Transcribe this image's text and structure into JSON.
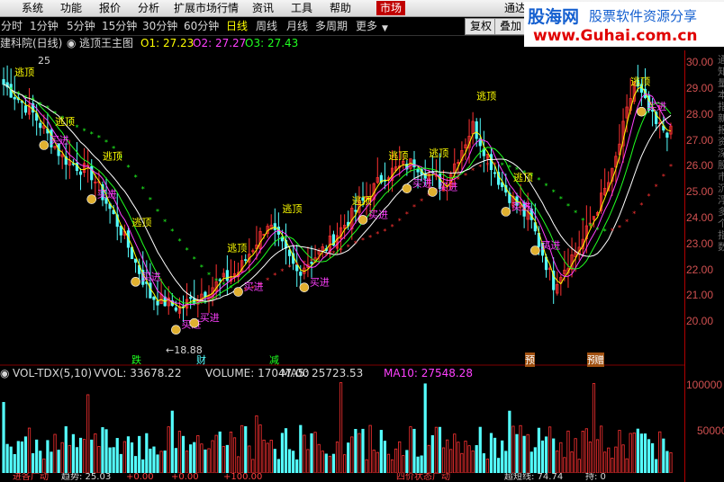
{
  "menu": [
    "系统",
    "功能",
    "报价",
    "分析",
    "扩展市场行情",
    "资讯",
    "工具",
    "帮助"
  ],
  "menu_active": "市场",
  "menu_right": "通达",
  "periods": [
    "分时",
    "1分钟",
    "5分钟",
    "15分钟",
    "30分钟",
    "60分钟",
    "日线",
    "周线",
    "月线",
    "多周期",
    "更多"
  ],
  "selected_period": "日线",
  "buttons": [
    "复权",
    "叠加"
  ],
  "logo": {
    "brand": "股海网",
    "slogan": "股票软件资源分享",
    "url": "www.Guhai.com.cn"
  },
  "price_header": {
    "stock": "建科院(日线)",
    "indicator": "逃顶王主图",
    "o1": "O1: 27.23",
    "o2": "O2: 27.27",
    "o3": "O3: 27.43",
    "level25": "25"
  },
  "price_axis": [
    "30.00",
    "29.00",
    "28.00",
    "27.00",
    "26.00",
    "25.00",
    "24.00",
    "23.00",
    "22.00",
    "21.00",
    "20.00"
  ],
  "vol_axis": [
    "100000",
    "50000"
  ],
  "low_marker": "←18.88",
  "signals": {
    "escape": "逃顶",
    "buy": "买进"
  },
  "event_labels": [
    "跌",
    "财",
    "减",
    "预",
    "预",
    "赠"
  ],
  "volume_header": {
    "name": "VOL-TDX(5,10)",
    "vvol": "VVOL: 33678.22",
    "volume": "VOLUME: 17047.00",
    "ma5": "MA5: 25723.53",
    "ma10": "MA10: 27548.28"
  },
  "bottom_text": [
    "进各广动",
    "趋势: 25.03",
    "+0.00",
    "+0.00",
    "+100.00",
    "四价状态广动",
    "超短线: 74.74",
    "持: 0"
  ],
  "side_text": "通知量本指新报资深股市沉浮多个指数",
  "colors": {
    "up": "#ff3232",
    "down": "#54ffff",
    "bg": "#000000",
    "escape": "#ffff00",
    "buy": "#ff40ff",
    "dotted": "#20ff20"
  },
  "chart_data": {
    "type": "candlestick",
    "price_range": [
      19.5,
      30.3
    ],
    "volume_range": [
      0,
      115000
    ]
  }
}
